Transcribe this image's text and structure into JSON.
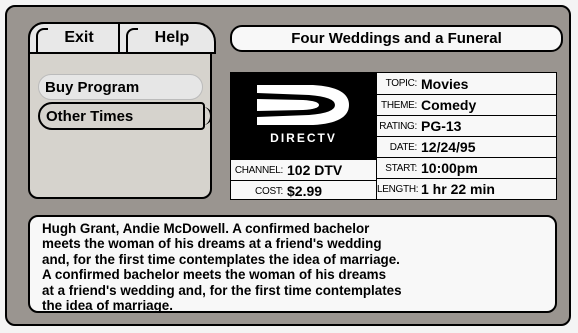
{
  "tabs": {
    "exit_label": "Exit",
    "help_label": "Help"
  },
  "menu": {
    "buy_label": "Buy Program",
    "other_label": "Other Times"
  },
  "program": {
    "title": "Four Weddings and a Funeral",
    "logo_text": "DIRECTV",
    "channel_label": "CHANNEL:",
    "channel_value": "102 DTV",
    "cost_label": "COST:",
    "cost_value": "$2.99",
    "topic_label": "TOPIC:",
    "topic_value": "Movies",
    "theme_label": "THEME:",
    "theme_value": "Comedy",
    "rating_label": "RATING:",
    "rating_value": "PG-13",
    "date_label": "DATE:",
    "date_value": "12/24/95",
    "start_label": "START:",
    "start_value": "10:00pm",
    "length_label": "LENGTH:",
    "length_value": "1 hr 22 min"
  },
  "description": "Hugh Grant, Andie McDowell. A confirmed bachelor\nmeets the woman of his dreams at a friend's wedding\nand, for the first time contemplates the idea of marriage.\nA confirmed bachelor meets the woman of his dreams\nat a friend's wedding and, for the first time contemplates\nthe idea of marriage.",
  "colors": {
    "frame": "#9a9590",
    "panel": "#d6d3cd",
    "box": "#f8f8f8",
    "logo_bg": "#000000"
  }
}
